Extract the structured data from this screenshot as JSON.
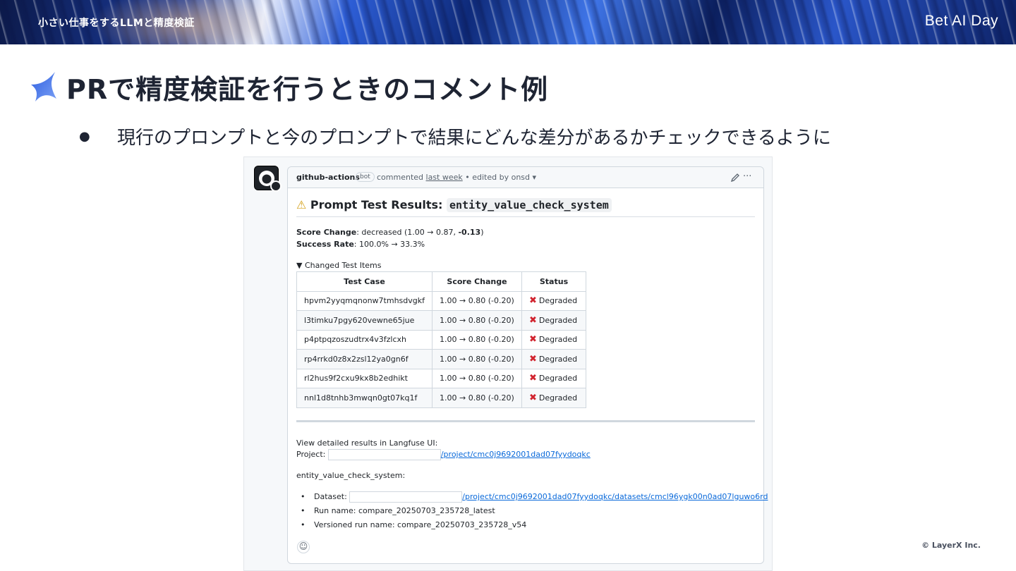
{
  "header": {
    "section_title": "小さい仕事をするLLMと精度検証",
    "brand": "Bet AI Day"
  },
  "slide": {
    "title": "PRで精度検証を行うときのコメント例",
    "bullet": "現行のプロンプトと今のプロンプトで結果にどんな差分があるかチェックできるように"
  },
  "comment": {
    "author": "github-actions",
    "badge": "bot",
    "meta_prefix": "commented",
    "meta_when": "last week",
    "meta_suffix": "• edited by onsd",
    "result_title_prefix": "Prompt Test Results:",
    "result_title_code": "entity_value_check_system",
    "score_change_label": "Score Change",
    "score_change_value": ": decreased (1.00 → 0.87, ",
    "score_change_delta": "-0.13",
    "score_change_end": ")",
    "success_rate_label": "Success Rate",
    "success_rate_value": ": 100.0% → 33.3%",
    "details_summary": "▼ Changed Test Items",
    "table": {
      "headers": [
        "Test Case",
        "Score Change",
        "Status"
      ],
      "rows": [
        [
          "hpvm2yyqmqnonw7tmhsdvgkf",
          "1.00 → 0.80 (-0.20)",
          "Degraded"
        ],
        [
          "l3timku7pgy620vewne65jue",
          "1.00 → 0.80 (-0.20)",
          "Degraded"
        ],
        [
          "p4ptpqzoszudtrx4v3fzlcxh",
          "1.00 → 0.80 (-0.20)",
          "Degraded"
        ],
        [
          "rp4rrkd0z8x2zsl12ya0gn6f",
          "1.00 → 0.80 (-0.20)",
          "Degraded"
        ],
        [
          "rl2hus9f2cxu9kx8b2edhikt",
          "1.00 → 0.80 (-0.20)",
          "Degraded"
        ],
        [
          "nnl1d8tnhb3mwqn0gt07kq1f",
          "1.00 → 0.80 (-0.20)",
          "Degraded"
        ]
      ]
    },
    "view_results": "View detailed results in Langfuse UI:",
    "project_label": "Project:",
    "project_link": "/project/cmc0j9692001dad07fyydoqkc",
    "system_name": "entity_value_check_system:",
    "dataset_label": "Dataset:",
    "dataset_link": "/project/cmc0j9692001dad07fyydoqkc/datasets/cmcl96ygk00n0ad07lguwo6rd",
    "run_name": "Run name: compare_20250703_235728_latest",
    "versioned_run_name": "Versioned run name: compare_20250703_235728_v54"
  },
  "footer": {
    "copyright": "© LayerX Inc."
  }
}
